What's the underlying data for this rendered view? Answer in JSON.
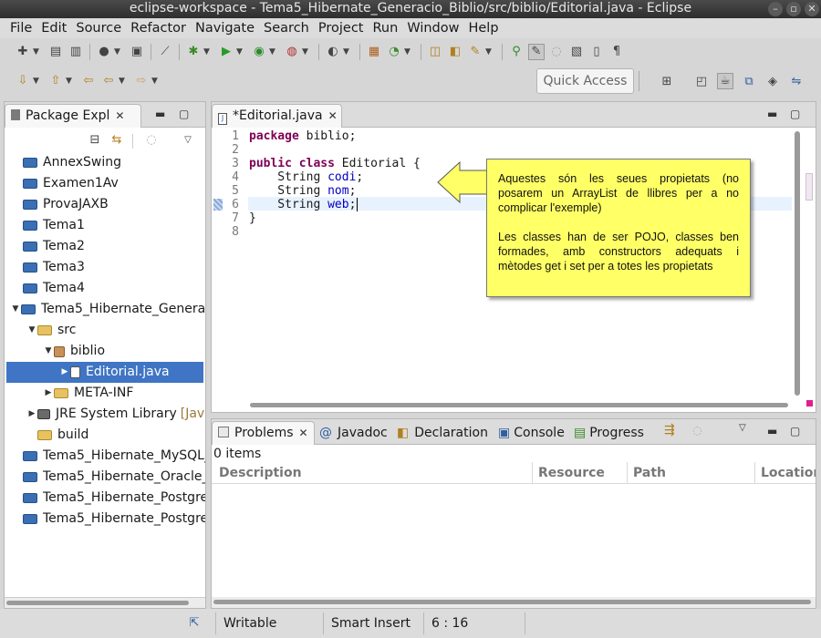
{
  "window": {
    "title": "eclipse-workspace - Tema5_Hibernate_Generacio_Biblio/src/biblio/Editorial.java - Eclipse"
  },
  "menu": [
    "File",
    "Edit",
    "Source",
    "Refactor",
    "Navigate",
    "Search",
    "Project",
    "Run",
    "Window",
    "Help"
  ],
  "toolbar": {
    "quick_access": "Quick Access"
  },
  "package_explorer": {
    "title": "Package Expl",
    "items": [
      {
        "label": "AnnexSwing"
      },
      {
        "label": "Examen1Av"
      },
      {
        "label": "ProvaJAXB"
      },
      {
        "label": "Tema1"
      },
      {
        "label": "Tema2"
      },
      {
        "label": "Tema3"
      },
      {
        "label": "Tema4"
      },
      {
        "label": "Tema5_Hibernate_Genera"
      },
      {
        "label": "src"
      },
      {
        "label": "biblio"
      },
      {
        "label": "Editorial.java"
      },
      {
        "label": "META-INF"
      },
      {
        "label": "JRE System Library",
        "suffix": "[Jav"
      },
      {
        "label": "build"
      },
      {
        "label": "Tema5_Hibernate_MySQL_"
      },
      {
        "label": "Tema5_Hibernate_Oracle_"
      },
      {
        "label": "Tema5_Hibernate_Postgre"
      },
      {
        "label": "Tema5_Hibernate_Postgre"
      }
    ]
  },
  "editor": {
    "tab": "*Editorial.java",
    "line_numbers": [
      "1",
      "2",
      "3",
      "4",
      "5",
      "6",
      "7",
      "8"
    ],
    "code": {
      "l1_kw": "package",
      "l1_rest": " biblio;",
      "l3_kw1": "public",
      "l3_kw2": "class",
      "l3_rest": " Editorial {",
      "l4_type": "    String ",
      "l4_field": "codi",
      "l4_end": ";",
      "l5_type": "    String ",
      "l5_field": "nom",
      "l5_end": ";",
      "l6_type": "    String ",
      "l6_field": "web",
      "l6_end": ";",
      "l7": "}"
    }
  },
  "callout": {
    "p1": "Aquestes són les seues propietats (no posarem un ArrayList de llibres per a no complicar l'exemple)",
    "p2": "Les classes han de ser POJO, classes ben formades, amb constructors adequats i mètodes get i set per a totes les propietats"
  },
  "bottom_panel": {
    "tabs": [
      "Problems",
      "Javadoc",
      "Declaration",
      "Console",
      "Progress"
    ],
    "count": "0 items",
    "columns": [
      "Description",
      "Resource",
      "Path",
      "Location"
    ]
  },
  "statusbar": {
    "writable": "Writable",
    "insert_mode": "Smart Insert",
    "position": "6 : 16"
  }
}
